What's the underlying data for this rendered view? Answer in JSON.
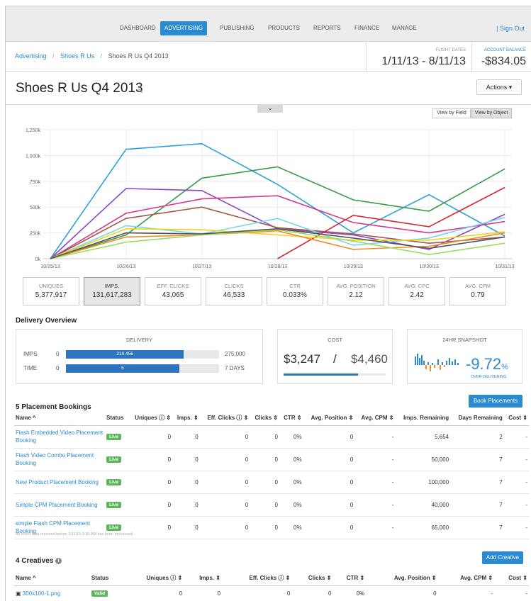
{
  "nav": {
    "items": [
      "DASHBOARD",
      "ADVERTISING",
      "PUBLISHING",
      "PRODUCTS",
      "REPORTS",
      "FINANCE",
      "MANAGE"
    ],
    "active": "ADVERTISING",
    "sign_out": "| Sign Out"
  },
  "breadcrumb": {
    "items": [
      "Advertising",
      "Shoes R Us",
      "Shoes R Us Q4 2013"
    ],
    "separator": "/"
  },
  "flight": {
    "label": "FLIGHT DATES",
    "value": "1/11/13 - 8/11/13"
  },
  "balance": {
    "label": "ACCOUNT BALANCE",
    "value": "-$834.05"
  },
  "page_title": "Shoes R Us Q4 2013",
  "actions_label": "Actions ▾",
  "collapse_glyph": "⌄",
  "view": {
    "field": "View by Field",
    "object": "View by Object"
  },
  "chart_data": {
    "type": "line",
    "x": [
      "10/25/13",
      "10/26/13",
      "10/27/13",
      "10/28/13",
      "10/29/13",
      "10/30/13",
      "10/31/13"
    ],
    "yticks": [
      "0k",
      "250k",
      "500k",
      "750k",
      "1,000k",
      "1,250k"
    ],
    "ylim": [
      0,
      1250000
    ],
    "grid": true,
    "series": [
      {
        "color": "#2ba3d9",
        "values": [
          0,
          1060000,
          1115000,
          720000,
          250000,
          620000,
          220000
        ]
      },
      {
        "color": "#3a9a4a",
        "values": [
          0,
          230000,
          780000,
          890000,
          570000,
          460000,
          870000
        ]
      },
      {
        "color": "#8e44c7",
        "values": [
          0,
          680000,
          660000,
          290000,
          230000,
          90000,
          430000
        ]
      },
      {
        "color": "#d23a8d",
        "values": [
          0,
          440000,
          580000,
          610000,
          350000,
          250000,
          360000
        ]
      },
      {
        "color": "#a05a4a",
        "values": [
          0,
          390000,
          500000,
          300000,
          240000,
          150000,
          210000
        ]
      },
      {
        "color": "#d72836",
        "values": [
          null,
          null,
          null,
          0,
          420000,
          310000,
          690000
        ]
      },
      {
        "color": "#79d6ea",
        "values": [
          0,
          320000,
          240000,
          390000,
          130000,
          200000,
          400000
        ]
      },
      {
        "color": "#f0d21e",
        "values": [
          0,
          290000,
          280000,
          230000,
          180000,
          180000,
          260000
        ]
      },
      {
        "color": "#f08c2a",
        "values": [
          0,
          210000,
          230000,
          270000,
          90000,
          120000,
          250000
        ]
      },
      {
        "color": "#9edb5e",
        "values": [
          0,
          160000,
          230000,
          280000,
          170000,
          40000,
          150000
        ]
      },
      {
        "color": "#555555",
        "values": [
          0,
          250000,
          240000,
          290000,
          200000,
          100000,
          210000
        ]
      }
    ]
  },
  "stats": [
    {
      "label": "UNIQUES",
      "value": "5,377,917"
    },
    {
      "label": "IMPS.",
      "value": "131,617,283"
    },
    {
      "label": "EFF. CLICKS",
      "value": "43,065"
    },
    {
      "label": "CLICKS",
      "value": "46,533"
    },
    {
      "label": "CTR",
      "value": "0.033%"
    },
    {
      "label": "AVG. POSITION",
      "value": "2.12"
    },
    {
      "label": "AVG. CPC",
      "value": "2.42"
    },
    {
      "label": "AVG. CPM",
      "value": "0.79"
    }
  ],
  "delivery": {
    "section_title": "Delivery Overview",
    "title": "DELIVERY",
    "imps": {
      "label": "IMPS",
      "min": "0",
      "value": "210,456",
      "max": "275,000",
      "fraction": 0.77
    },
    "time": {
      "label": "TIME",
      "min": "0",
      "value": "5",
      "max": "7 DAYS",
      "fraction": 0.74
    }
  },
  "cost": {
    "title": "COST",
    "spent": "$3,247",
    "separator": "/",
    "budget": "$4,460",
    "fraction": 0.73
  },
  "snapshot": {
    "title": "24HR SNAPSHOT",
    "value": "-9.72",
    "unit": "%",
    "caption": "OVER DELIVERING"
  },
  "placements": {
    "title": "5 Placement Bookings",
    "button": "Book Placements",
    "columns": [
      "Name ^",
      "Status",
      "Uniques ⓘ ⇕",
      "Imps. ⇕",
      "Eff. Clicks ⓘ ⇕",
      "Clicks ⇕",
      "CTR ⇕",
      "Avg. Position ⇕",
      "Avg. CPM ⇕",
      "Imps. Remaining",
      "Days Remaining",
      "Cost ⇕"
    ],
    "rows": [
      {
        "name": "Flash Embedded Video Placement Booking",
        "status": "Live",
        "uniques": "0",
        "imps": "0",
        "eff": "0",
        "clicks": "0",
        "ctr": "0%",
        "pos": "0",
        "cpm": "-",
        "rem": "5,654",
        "days": "2",
        "cost": "-"
      },
      {
        "name": "Flash Video Combo Placement Booking",
        "status": "Live",
        "uniques": "0",
        "imps": "0",
        "eff": "0",
        "clicks": "0",
        "ctr": "0%",
        "pos": "0",
        "cpm": "-",
        "rem": "50,000",
        "days": "7",
        "cost": "-"
      },
      {
        "name": "New Product Placement Booking",
        "status": "Live",
        "uniques": "0",
        "imps": "0",
        "eff": "0",
        "clicks": "0",
        "ctr": "0%",
        "pos": "0",
        "cpm": "-",
        "rem": "100,000",
        "days": "7",
        "cost": "-"
      },
      {
        "name": "Simple CPM Placement Booking",
        "status": "Live",
        "uniques": "0",
        "imps": "0",
        "eff": "0",
        "clicks": "0",
        "ctr": "0%",
        "pos": "0",
        "cpm": "-",
        "rem": "40,000",
        "days": "7",
        "cost": "-"
      },
      {
        "name": "simple Flash CPM Placement Booking",
        "status": "Live",
        "uniques": "0",
        "imps": "0",
        "eff": "0",
        "clicks": "0",
        "ctr": "0%",
        "pos": "0",
        "cpm": "-",
        "rem": "65,000",
        "days": "7",
        "cost": "-"
      }
    ],
    "note": "All event data received before 1/11/13 3:30 AM has been processed."
  },
  "creatives": {
    "title": "4 Creatives",
    "button": "Add Creative",
    "columns": [
      "Name ^",
      "Status",
      "Uniques ⓘ ⇕",
      "Imps. ⇕",
      "Eff. Clicks ⓘ ⇕",
      "Clicks ⇕",
      "CTR ⇕",
      "Avg. Position ⇕",
      "Avg. CPM ⇕",
      "Cost ⇕"
    ],
    "rows": [
      {
        "name": "300x100-1.png",
        "status": "Valid",
        "uniques": "0",
        "imps": "0",
        "eff": "0",
        "clicks": "0",
        "ctr": "0%",
        "pos": "0",
        "cpm": "-",
        "cost": "-"
      }
    ]
  }
}
